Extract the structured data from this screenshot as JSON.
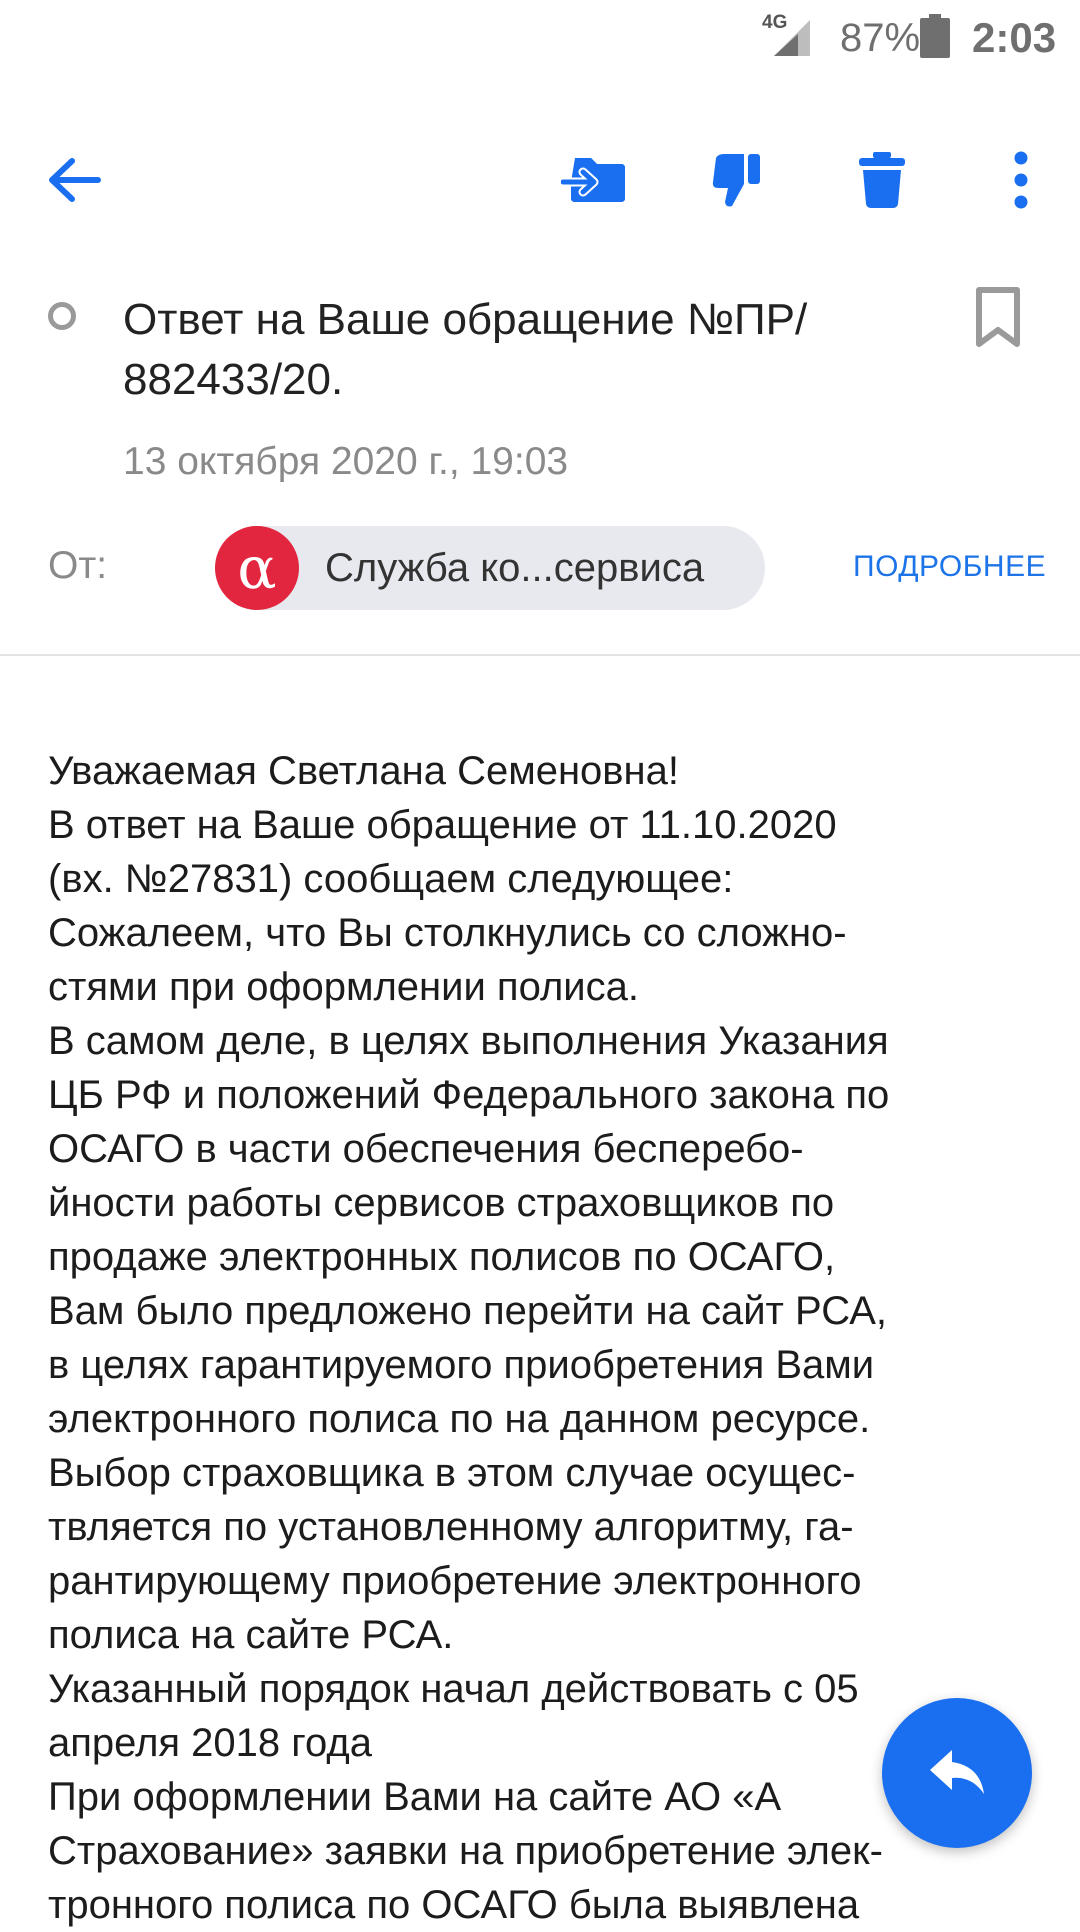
{
  "status_bar": {
    "network": "4G",
    "battery": "87%",
    "time": "2:03"
  },
  "toolbar": {
    "icons": [
      "back-arrow-icon",
      "move-to-folder-icon",
      "spam-thumbs-down-icon",
      "trash-icon",
      "more-vert-icon"
    ],
    "accent": "#1a6ff0"
  },
  "message": {
    "subject_line1": "Ответ на Ваше обращение №ПР/",
    "subject_line2": "882433/20.",
    "date": "13 октября 2020 г., 19:03",
    "from_label": "От:",
    "sender_name": "Служба ко...сервиса",
    "sender_avatar_glyph": "α",
    "details_link": "ПОДРОБНЕЕ",
    "body_lines": [
      "Уважаемая Светлана Семеновна!",
      "В ответ на Ваше обращение от 11.10.2020",
      "(вх. №27831) сообщаем следующее:",
      "Сожалеем, что Вы столкнулись со сложно-",
      "стями при оформлении полиса.",
      "В самом деле, в целях выполнения Указания",
      "ЦБ РФ и положений Федерального закона по",
      "ОСАГО в части обеспечения бесперебо-",
      "йности работы сервисов страховщиков по",
      "продаже электронных полисов по ОСАГО,",
      "Вам было предложено перейти на сайт РСА,",
      "в целях гарантируемого приобретения Вами",
      "электронного полиса по на данном ресурсе.",
      "Выбор страховщика в этом случае осущес-",
      "твляется по установленному алгоритму, га-",
      "рантирующему приобретение электронного",
      "полиса на сайте РСА.",
      "Указанный порядок начал действовать с 05",
      "апреля 2018 года",
      "При оформлении Вами на сайте АО «А",
      "Страхование» заявки на приобретение элек-",
      "тронного полиса по ОСАГО была выявлена"
    ]
  },
  "colors": {
    "accent_blue": "#1a6ff0",
    "sender_red": "#e3263f",
    "chip_bg": "#e8e9ee"
  }
}
